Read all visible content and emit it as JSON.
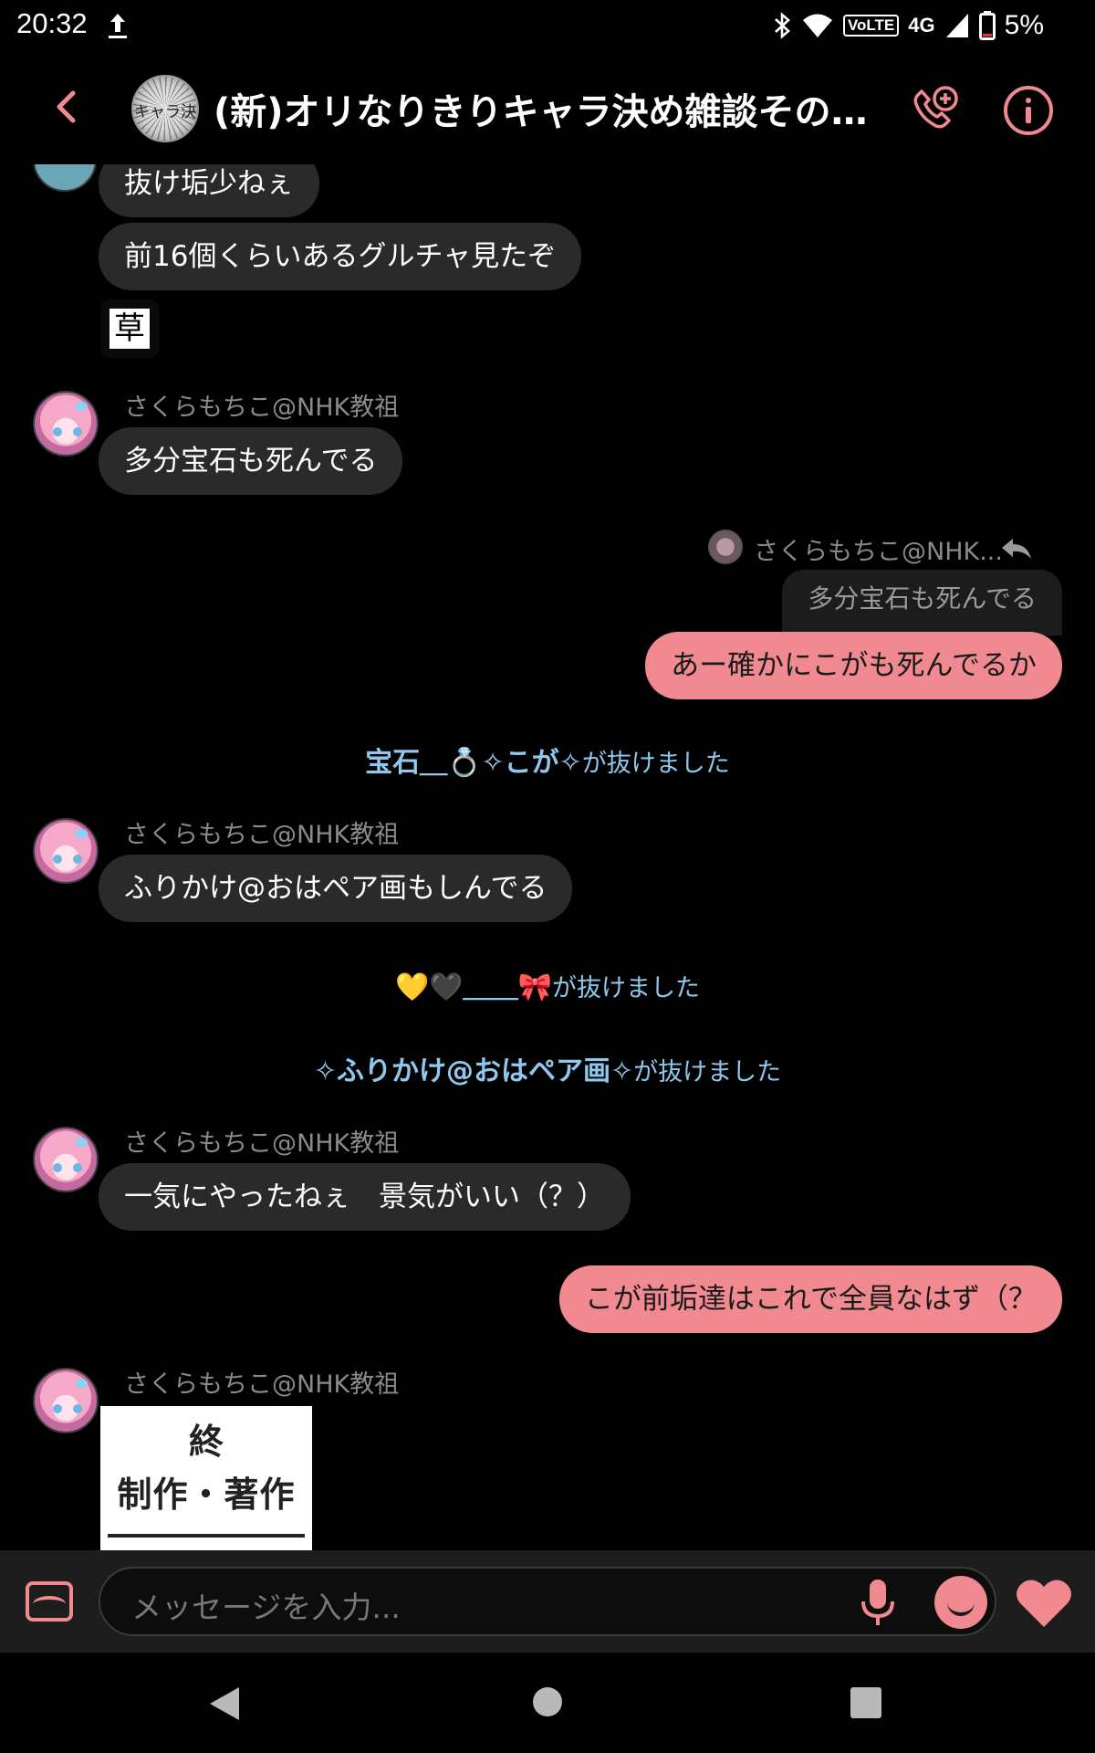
{
  "status_bar": {
    "time": "20:32",
    "volte": "VoLTE",
    "network": "4G",
    "battery": "5%"
  },
  "header": {
    "group_avatar_text": "キャラ決",
    "title": "(新)オリなりきりキャラ決め雑談その他..."
  },
  "messages": {
    "m1": "抜け垢少ねぇ",
    "m2": "前16個くらいあるグルチャ見たぞ",
    "m3_stamp": "草",
    "sender1": "さくらもちこ@NHK教祖",
    "m4": "多分宝石も死んでる",
    "reply_to_name": "さくらもちこ@NHK...",
    "reply_quote": "多分宝石も死んでる",
    "m5": "あー確かにこがも死んでるか",
    "sys1_name": "宝石＿💍✧こが✧",
    "sys1_text": "が抜けました",
    "sender2": "さくらもちこ@NHK教祖",
    "m6": "ふりかけ@おはペア画もしんでる",
    "sys2_name": "💛🖤＿＿🎀",
    "sys2_text": "が抜けました",
    "sys3_name": "✧ふりかけ@おはペア画✧",
    "sys3_text": "が抜けました",
    "sender3": "さくらもちこ@NHK教祖",
    "m7": "一気にやったねぇ　景気がいい（？）",
    "m8": "こが前垢達はこれで全員なはず（？",
    "sender4": "さくらもちこ@NHK教祖",
    "image_line1": "終",
    "image_line2": "制作・著作"
  },
  "composer": {
    "placeholder": "メッセージを入力..."
  },
  "colors": {
    "accent": "#f08a90",
    "system_text": "#8fc8ec",
    "bubble_other": "#2a2a2a",
    "background": "#000000"
  }
}
